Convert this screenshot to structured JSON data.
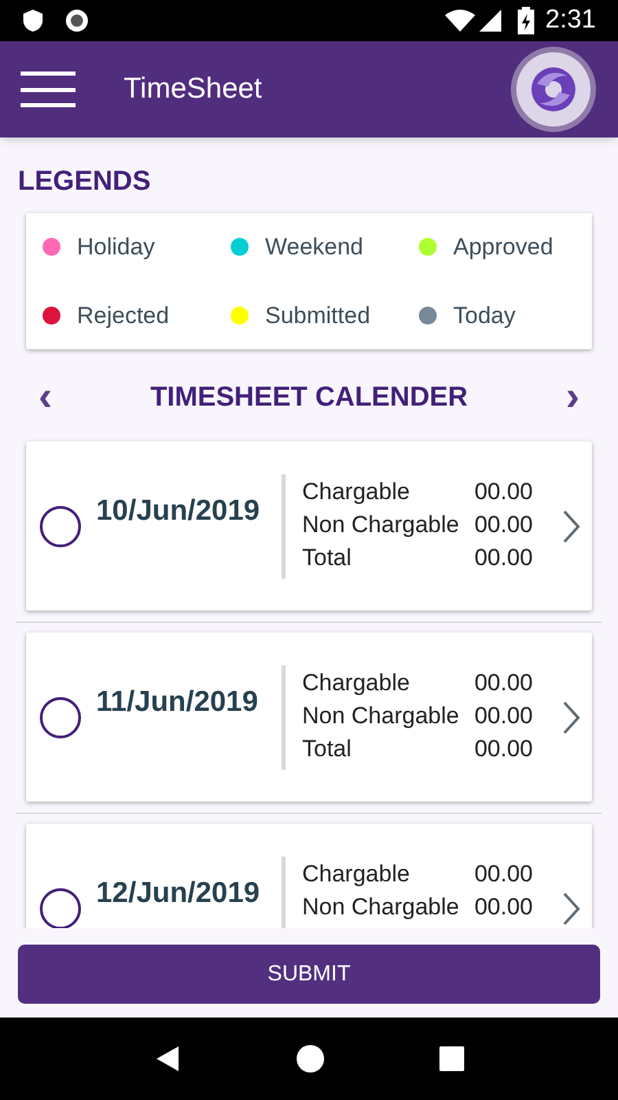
{
  "status_bar": {
    "time": "2:31"
  },
  "app_bar": {
    "title": "TimeSheet"
  },
  "legends": {
    "title": "LEGENDS",
    "items": [
      {
        "label": "Holiday",
        "color": "#ff69b4"
      },
      {
        "label": "Weekend",
        "color": "#00ced1"
      },
      {
        "label": "Approved",
        "color": "#adff2f"
      },
      {
        "label": "Rejected",
        "color": "#dc143c"
      },
      {
        "label": "Submitted",
        "color": "#ffff00"
      },
      {
        "label": "Today",
        "color": "#778899"
      }
    ]
  },
  "calendar": {
    "title": "TIMESHEET CALENDER",
    "prev": "‹",
    "next": "›"
  },
  "days": [
    {
      "date": "10/Jun/2019",
      "selected": false,
      "rows": [
        {
          "label": "Chargable",
          "value": "00.00"
        },
        {
          "label": "Non Chargable",
          "value": "00.00"
        },
        {
          "label": "Total",
          "value": "00.00"
        }
      ]
    },
    {
      "date": "11/Jun/2019",
      "selected": false,
      "rows": [
        {
          "label": "Chargable",
          "value": "00.00"
        },
        {
          "label": "Non Chargable",
          "value": "00.00"
        },
        {
          "label": "Total",
          "value": "00.00"
        }
      ]
    },
    {
      "date": "12/Jun/2019",
      "selected": false,
      "rows": [
        {
          "label": "Chargable",
          "value": "00.00"
        },
        {
          "label": "Non Chargable",
          "value": "00.00"
        }
      ]
    }
  ],
  "submit": "SUBMIT"
}
